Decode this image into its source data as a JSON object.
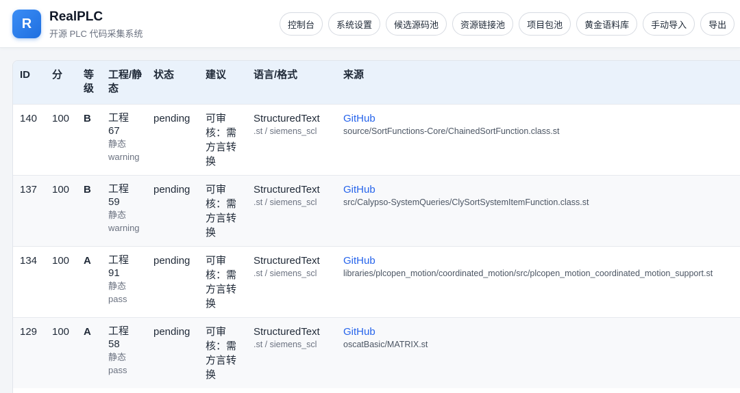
{
  "app": {
    "logo_letter": "R",
    "title": "RealPLC",
    "subtitle": "开源 PLC 代码采集系统"
  },
  "nav": [
    "控制台",
    "系统设置",
    "候选源码池",
    "资源链接池",
    "项目包池",
    "黄金语料库",
    "手动导入",
    "导出"
  ],
  "table": {
    "headers": {
      "id": "ID",
      "score": "分",
      "grade": "等级",
      "project": "工程/静态",
      "status": "状态",
      "suggest": "建议",
      "lang": "语言/格式",
      "source": "来源"
    },
    "rows": [
      {
        "id": "140",
        "score": "100",
        "grade": "B",
        "project": "工程 67",
        "static_label": "静态",
        "static_value": "warning",
        "status": "pending",
        "suggest": "可审核：需方言转换",
        "lang": "StructuredText",
        "format": ".st / siemens_scl",
        "source": "GitHub",
        "path": "source/SortFunctions-Core/ChainedSortFunction.class.st"
      },
      {
        "id": "137",
        "score": "100",
        "grade": "B",
        "project": "工程 59",
        "static_label": "静态",
        "static_value": "warning",
        "status": "pending",
        "suggest": "可审核：需方言转换",
        "lang": "StructuredText",
        "format": ".st / siemens_scl",
        "source": "GitHub",
        "path": "src/Calypso-SystemQueries/ClySortSystemItemFunction.class.st"
      },
      {
        "id": "134",
        "score": "100",
        "grade": "A",
        "project": "工程 91",
        "static_label": "静态",
        "static_value": "pass",
        "status": "pending",
        "suggest": "可审核：需方言转换",
        "lang": "StructuredText",
        "format": ".st / siemens_scl",
        "source": "GitHub",
        "path": "libraries/plcopen_motion/coordinated_motion/src/plcopen_motion_coordinated_motion_support.st"
      },
      {
        "id": "129",
        "score": "100",
        "grade": "A",
        "project": "工程 58",
        "static_label": "静态",
        "static_value": "pass",
        "status": "pending",
        "suggest": "可审核：需方言转换",
        "lang": "StructuredText",
        "format": ".st / siemens_scl",
        "source": "GitHub",
        "path": "oscatBasic/MATRIX.st"
      }
    ]
  },
  "colors": {
    "accent": "#2563eb",
    "header_bg": "#eaf2fb",
    "logo": "#1f6fe0"
  }
}
